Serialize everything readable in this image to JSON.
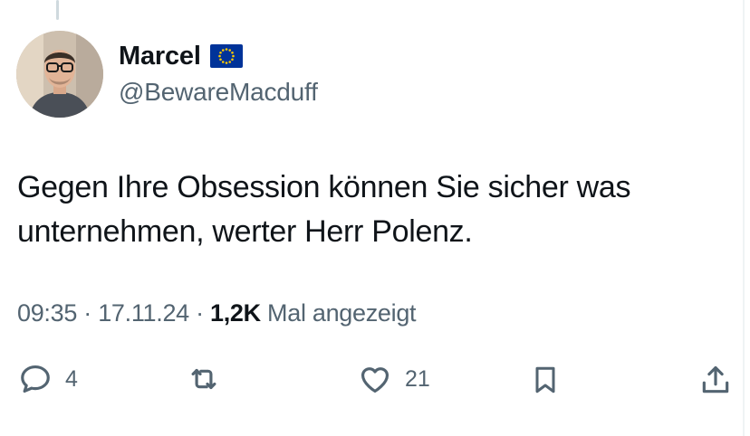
{
  "author": {
    "display_name": "Marcel",
    "handle": "@BewareMacduff",
    "badge_icon": "eu-flag-icon"
  },
  "tweet": {
    "text_line1": "Gegen Ihre Obsession können Sie sicher was",
    "text_line2": "unternehmen, werter Herr Polenz."
  },
  "meta": {
    "time": "09:35",
    "separator": " · ",
    "date": "17.11.24",
    "views_count": "1,2K",
    "views_label": " Mal angezeigt"
  },
  "actions": {
    "reply": {
      "icon": "reply-icon",
      "count": "4"
    },
    "retweet": {
      "icon": "retweet-icon"
    },
    "like": {
      "icon": "heart-icon",
      "count": "21"
    },
    "bookmark": {
      "icon": "bookmark-icon"
    },
    "share": {
      "icon": "share-icon"
    }
  },
  "colors": {
    "text_primary": "#0f1419",
    "text_secondary": "#536471",
    "eu_blue": "#003399",
    "eu_gold": "#ffcc00"
  }
}
